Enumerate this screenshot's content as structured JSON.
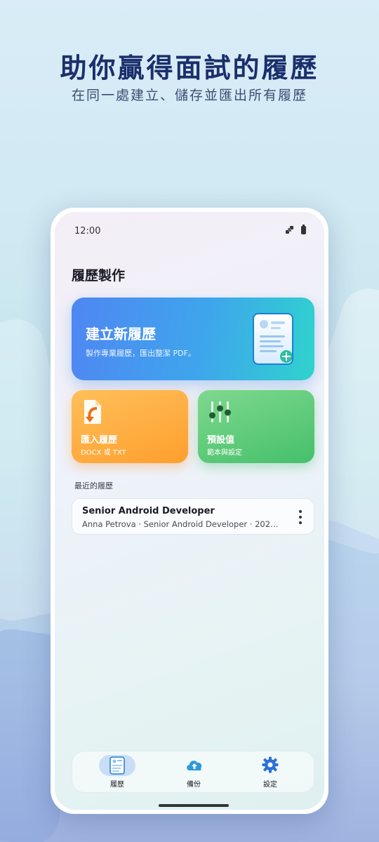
{
  "marketing": {
    "headline": "助你贏得面試的履歷",
    "subline": "在同一處建立、儲存並匯出所有履歷"
  },
  "status_bar": {
    "time": "12:00"
  },
  "page": {
    "title": "履歷製作"
  },
  "create_card": {
    "title": "建立新履歷",
    "subtitle": "製作專業履歷，匯出整潔 PDF。"
  },
  "import_card": {
    "title": "匯入履歷",
    "subtitle": "DOCX 或 TXT"
  },
  "preset_card": {
    "title": "預設值",
    "subtitle": "範本與設定"
  },
  "recent": {
    "label": "最近的履歷",
    "items": [
      {
        "title": "Senior Android Developer",
        "subtitle": "Anna Petrova · Senior Android Developer · 2026..."
      }
    ]
  },
  "bottom_nav": {
    "items": [
      {
        "label": "履歷",
        "icon": "resume-icon",
        "active": true
      },
      {
        "label": "備份",
        "icon": "cloud-upload-icon",
        "active": false
      },
      {
        "label": "設定",
        "icon": "gear-icon",
        "active": false
      }
    ]
  },
  "colors": {
    "headline": "#1a2f6b",
    "create_card_start": "#4f86f2",
    "create_card_end": "#2fd3cd",
    "import_card": "#ff9f2e",
    "preset_card": "#45c06a",
    "nav_active_pill": "#c9def6"
  }
}
